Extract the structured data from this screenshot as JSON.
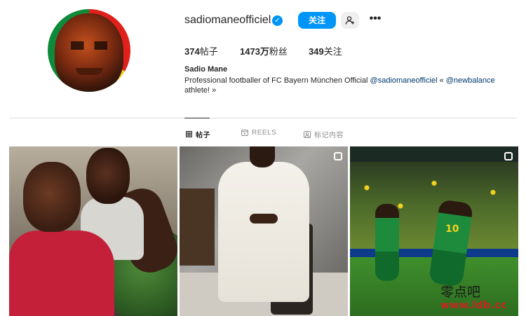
{
  "profile": {
    "username": "sadiomaneofficiel",
    "verified_icon": "verified-badge-icon",
    "follow_label": "关注",
    "suggest_icon": "person-add-icon",
    "more_icon": "more-icon",
    "more_label": "•••",
    "avatar_colors": [
      "#e0201a",
      "#f2cf1b",
      "#0f8a3a"
    ]
  },
  "stats": {
    "posts_count": "374",
    "posts_label": "帖子",
    "followers_count": "1473万",
    "followers_label": "粉丝",
    "following_count": "349",
    "following_label": "关注"
  },
  "bio": {
    "full_name": "Sadio Mane",
    "text_before": "Professional footballer of FC Bayern München Official ",
    "mention1": "@sadiomaneofficiel",
    "text_mid": " « ",
    "mention2": "@newbalance",
    "text_after": " athlete! »"
  },
  "tabs": [
    {
      "label": "帖子",
      "icon": "grid-icon",
      "active": true
    },
    {
      "label": "REELS",
      "icon": "reels-icon",
      "active": false
    },
    {
      "label": "标记内容",
      "icon": "tagged-icon",
      "active": false
    }
  ],
  "posts": [
    {
      "type": "photo"
    },
    {
      "type": "carousel",
      "icon": "carousel-icon"
    },
    {
      "type": "carousel",
      "icon": "carousel-icon",
      "jersey_number": "10"
    }
  ],
  "watermark": {
    "line1": "零点吧",
    "line2": "www.ldb.cc"
  },
  "colors": {
    "accent": "#0095f6",
    "link": "#00376b",
    "text": "#262626",
    "muted": "#8e8e8e",
    "divider": "#dbdbdb"
  }
}
